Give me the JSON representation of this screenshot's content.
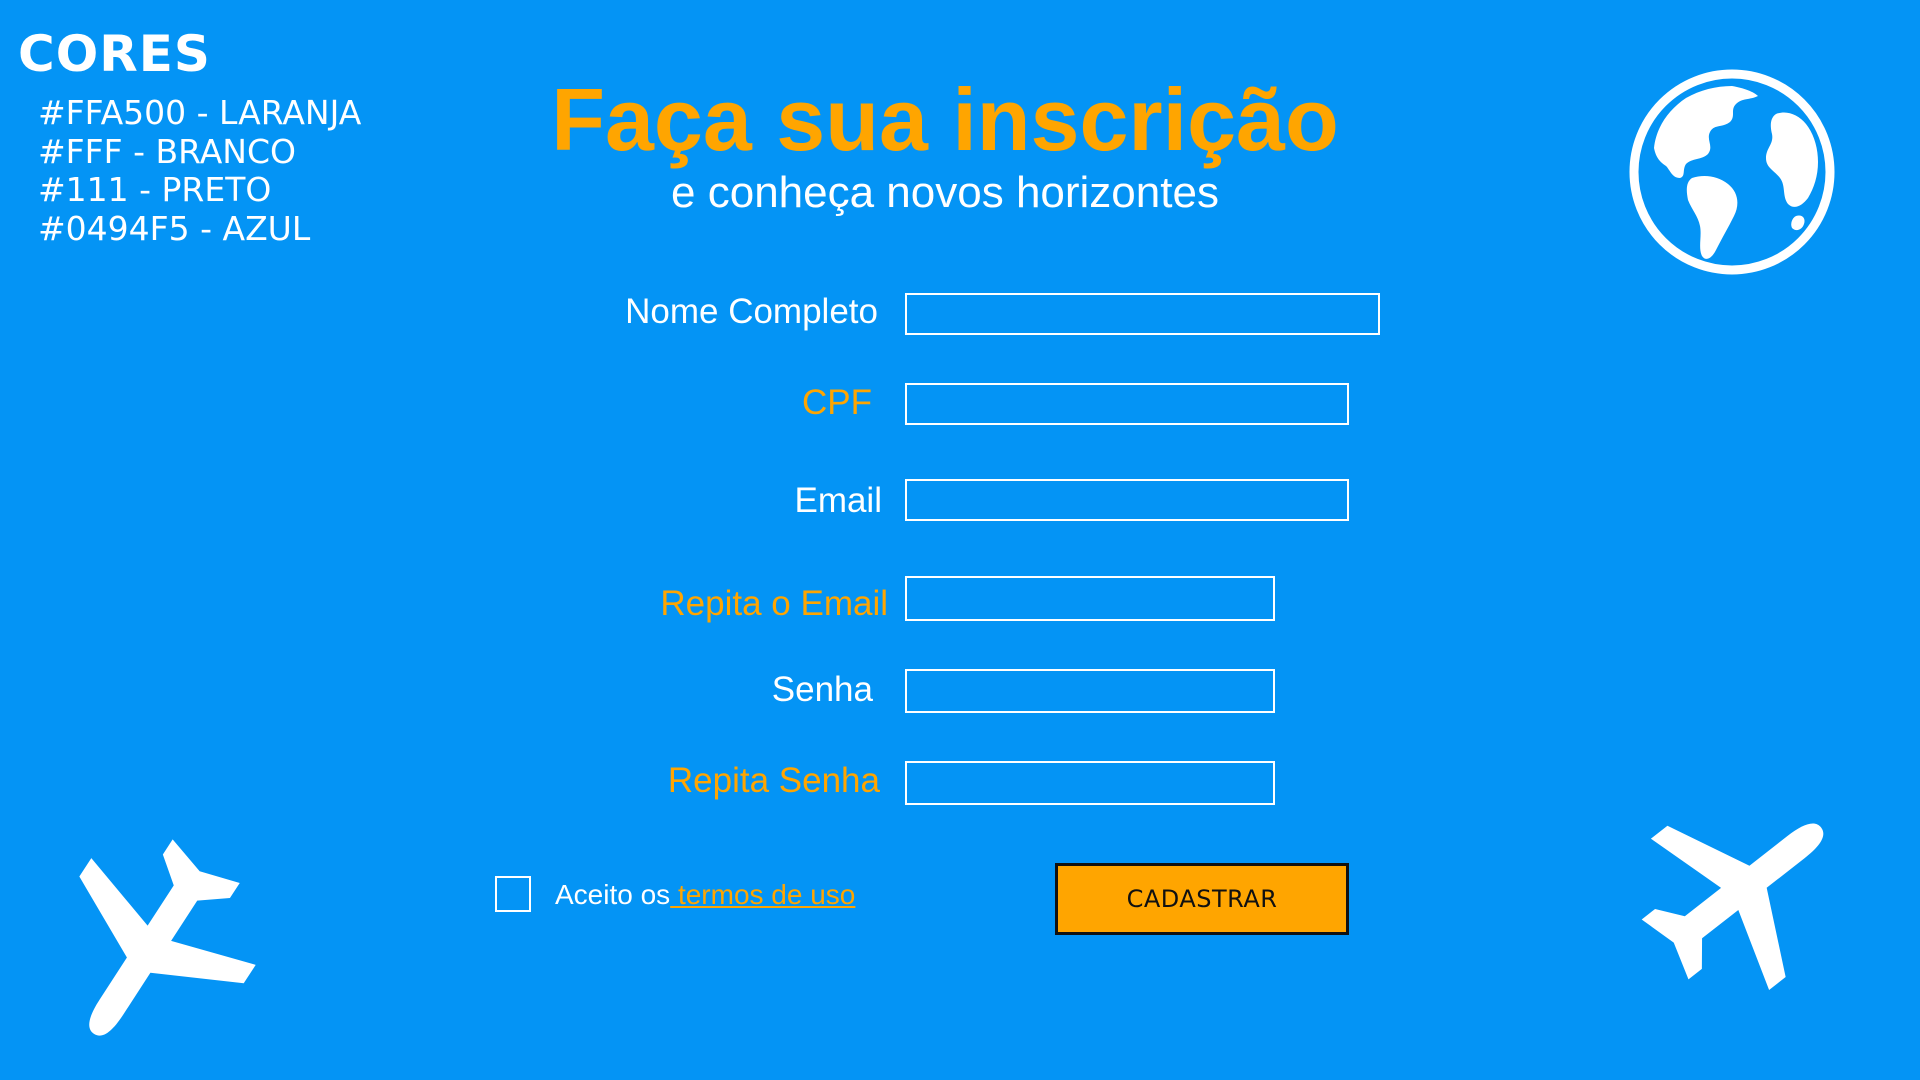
{
  "palette": {
    "title": "CORES",
    "items": [
      "#FFA500 - LARANJA",
      "#FFF - BRANCO",
      "#111 - PRETO",
      "#0494F5 - AZUL"
    ]
  },
  "header": {
    "title": "Faça sua inscrição",
    "subtitle": "e conheça novos horizontes"
  },
  "form": {
    "fields": [
      {
        "label": "Nome Completo",
        "value": ""
      },
      {
        "label": "CPF",
        "value": ""
      },
      {
        "label": "Email",
        "value": ""
      },
      {
        "label": "Repita o Email",
        "value": ""
      },
      {
        "label": "Senha",
        "value": ""
      },
      {
        "label": "Repita Senha",
        "value": ""
      }
    ],
    "accept_text": "Aceito os",
    "terms_link": " termos de uso",
    "submit_label": "CADASTRAR"
  },
  "colors": {
    "orange": "#FFA500",
    "white": "#FFFFFF",
    "black": "#111111",
    "blue": "#0494F5"
  },
  "icons": {
    "globe": "globe-icon",
    "airplane_left": "airplane-icon",
    "airplane_right": "airplane-icon"
  }
}
